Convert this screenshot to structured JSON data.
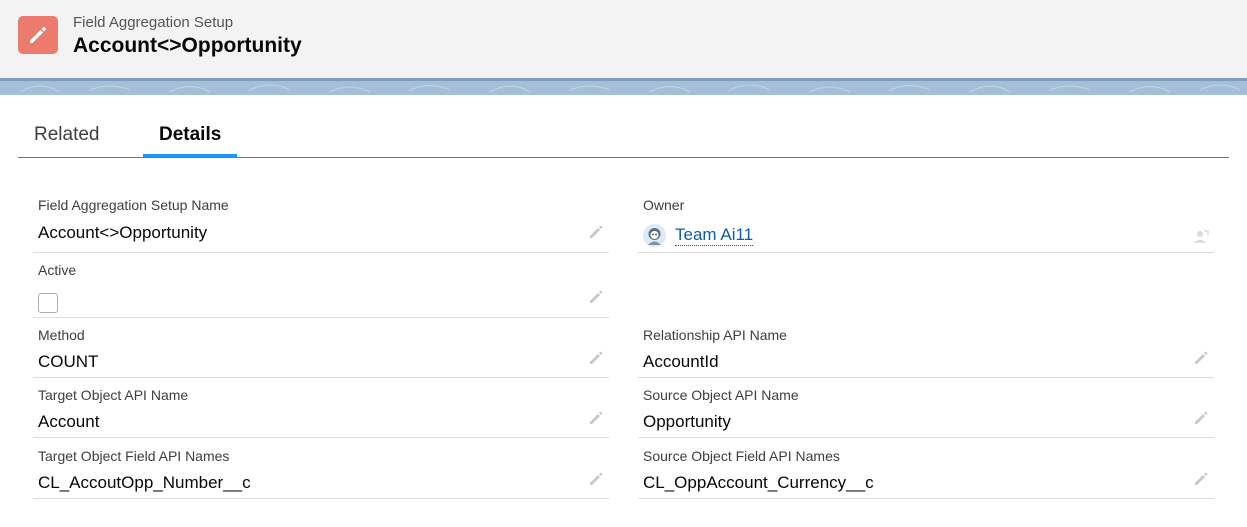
{
  "header": {
    "object_type": "Field Aggregation Setup",
    "record_title": "Account<>Opportunity",
    "icon": "edit-pencil-icon",
    "icon_color": "#eb7b6c"
  },
  "tabs": [
    {
      "label": "Related",
      "active": false
    },
    {
      "label": "Details",
      "active": true
    }
  ],
  "fields": {
    "name": {
      "label": "Field Aggregation Setup Name",
      "value": "Account<>Opportunity"
    },
    "owner": {
      "label": "Owner",
      "value": "Team Ai11"
    },
    "active": {
      "label": "Active",
      "checked": false
    },
    "method": {
      "label": "Method",
      "value": "COUNT"
    },
    "relationship_api_name": {
      "label": "Relationship API Name",
      "value": "AccountId"
    },
    "target_object": {
      "label": "Target Object API Name",
      "value": "Account"
    },
    "source_object": {
      "label": "Source Object API Name",
      "value": "Opportunity"
    },
    "target_fields": {
      "label": "Target Object Field API Names",
      "value": "CL_AccoutOpp_Number__c"
    },
    "source_fields": {
      "label": "Source Object Field API Names",
      "value": "CL_OppAccount_Currency__c"
    }
  },
  "colors": {
    "accent": "#1b96ff",
    "link": "#0b5cab"
  }
}
